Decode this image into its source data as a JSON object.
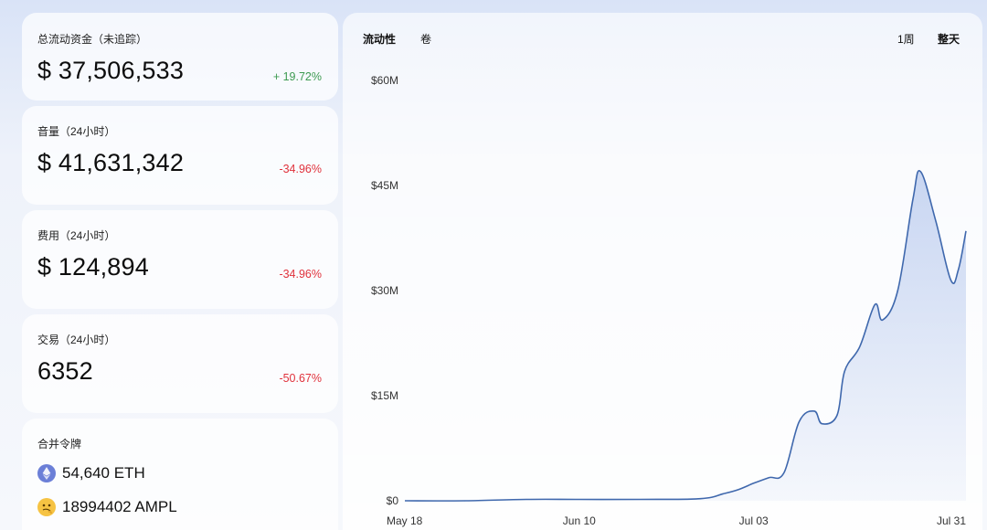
{
  "stats": {
    "tvl": {
      "label": "总流动资金（未追踪）",
      "value": "$ 37,506,533",
      "change": "+ 19.72%"
    },
    "volume": {
      "label": "音量（24小时）",
      "value": "$ 41,631,342",
      "change": "-34.96%"
    },
    "fees": {
      "label": "费用（24小时）",
      "value": "$ 124,894",
      "change": "-34.96%"
    },
    "transactions": {
      "label": "交易（24小时）",
      "value": "6352",
      "change": "-50.67%"
    }
  },
  "tokens": {
    "label": "合并令牌",
    "items": [
      {
        "amount": "54,640 ETH",
        "icon": "ethereum-icon"
      },
      {
        "amount": "18994402 AMPL",
        "icon": "ampl-emoji-icon"
      }
    ]
  },
  "chart_tabs": {
    "liquidity": "流动性",
    "volume": "卷",
    "week": "1周",
    "all": "整天"
  },
  "colors": {
    "positive": "#3d9a51",
    "negative": "#e0323c",
    "line": "#3f68ad",
    "area": "#c6d4f1"
  },
  "chart_data": {
    "type": "area",
    "title": "",
    "xlabel": "",
    "ylabel": "",
    "x_tick_labels": [
      "May 18",
      "Jun 10",
      "Jul 03",
      "Jul 31"
    ],
    "y_tick_labels": [
      "$0",
      "$15M",
      "$30M",
      "$45M",
      "$60M"
    ],
    "y_ticks": [
      0,
      15,
      30,
      45,
      60
    ],
    "ylim": [
      0,
      60
    ],
    "y_unit": "M USD",
    "grid": false,
    "x": [
      "May 18",
      "May 26",
      "Jun 03",
      "Jun 10",
      "Jun 18",
      "Jun 26",
      "Jun 29",
      "Jul 01",
      "Jul 03",
      "Jul 05",
      "Jul 07",
      "Jul 09",
      "Jul 11",
      "Jul 12",
      "Jul 14",
      "Jul 15",
      "Jul 17",
      "Jul 19",
      "Jul 20",
      "Jul 22",
      "Jul 24",
      "Jul 25",
      "Jul 27",
      "Jul 29",
      "Jul 30",
      "Jul 31"
    ],
    "values": [
      0,
      0,
      0.2,
      0.2,
      0.2,
      0.3,
      1.0,
      1.6,
      2.5,
      3.3,
      4.0,
      11.3,
      12.8,
      11.0,
      12.2,
      18.5,
      22.0,
      28.0,
      25.8,
      30.0,
      43.0,
      47.0,
      40.0,
      31.5,
      33.0,
      38.5
    ]
  }
}
